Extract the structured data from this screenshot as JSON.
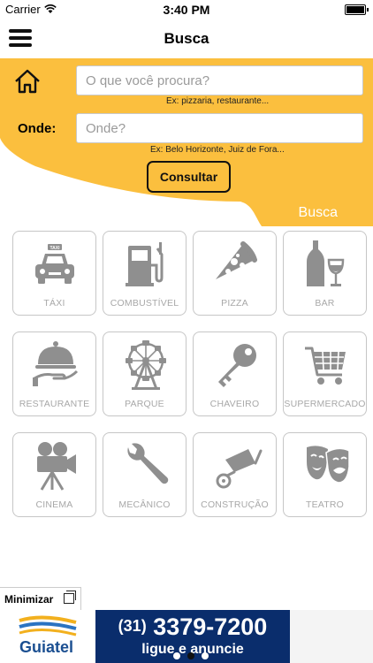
{
  "status_bar": {
    "carrier": "Carrier",
    "time": "3:40 PM"
  },
  "nav": {
    "title": "Busca",
    "menu_icon": "hamburger-menu-icon"
  },
  "search": {
    "home_icon": "home-icon",
    "what_placeholder": "O que você procura?",
    "what_hint": "Ex: pizzaria, restaurante...",
    "where_label": "Onde:",
    "where_placeholder": "Onde?",
    "where_hint": "Ex: Belo Horizonte, Juiz de Fora...",
    "submit_label": "Consultar",
    "tab_label": "Busca"
  },
  "categories": [
    {
      "label": "TÁXI",
      "icon": "taxi-icon"
    },
    {
      "label": "COMBUSTÍVEL",
      "icon": "fuel-pump-icon"
    },
    {
      "label": "PIZZA",
      "icon": "pizza-icon"
    },
    {
      "label": "BAR",
      "icon": "wine-bottle-icon"
    },
    {
      "label": "RESTAURANTE",
      "icon": "serving-cloche-icon"
    },
    {
      "label": "PARQUE",
      "icon": "ferris-wheel-icon"
    },
    {
      "label": "CHAVEIRO",
      "icon": "key-icon"
    },
    {
      "label": "SUPERMERCADO",
      "icon": "shopping-cart-icon"
    },
    {
      "label": "CINEMA",
      "icon": "movie-camera-icon"
    },
    {
      "label": "MECÂNICO",
      "icon": "wrench-icon"
    },
    {
      "label": "CONSTRUÇÃO",
      "icon": "wheelbarrow-icon"
    },
    {
      "label": "TEATRO",
      "icon": "theater-masks-icon"
    }
  ],
  "minimize": {
    "label": "Minimizar"
  },
  "ad": {
    "brand": "Guiatel",
    "phone_area": "(31)",
    "phone_number": "3379-7200",
    "tagline": "ligue e anuncie",
    "page_count": 3,
    "current_page": 2
  },
  "colors": {
    "accent": "#FBBF3E",
    "tile_icon": "#8f8f8f",
    "ad_blue": "#0A2D6C"
  }
}
